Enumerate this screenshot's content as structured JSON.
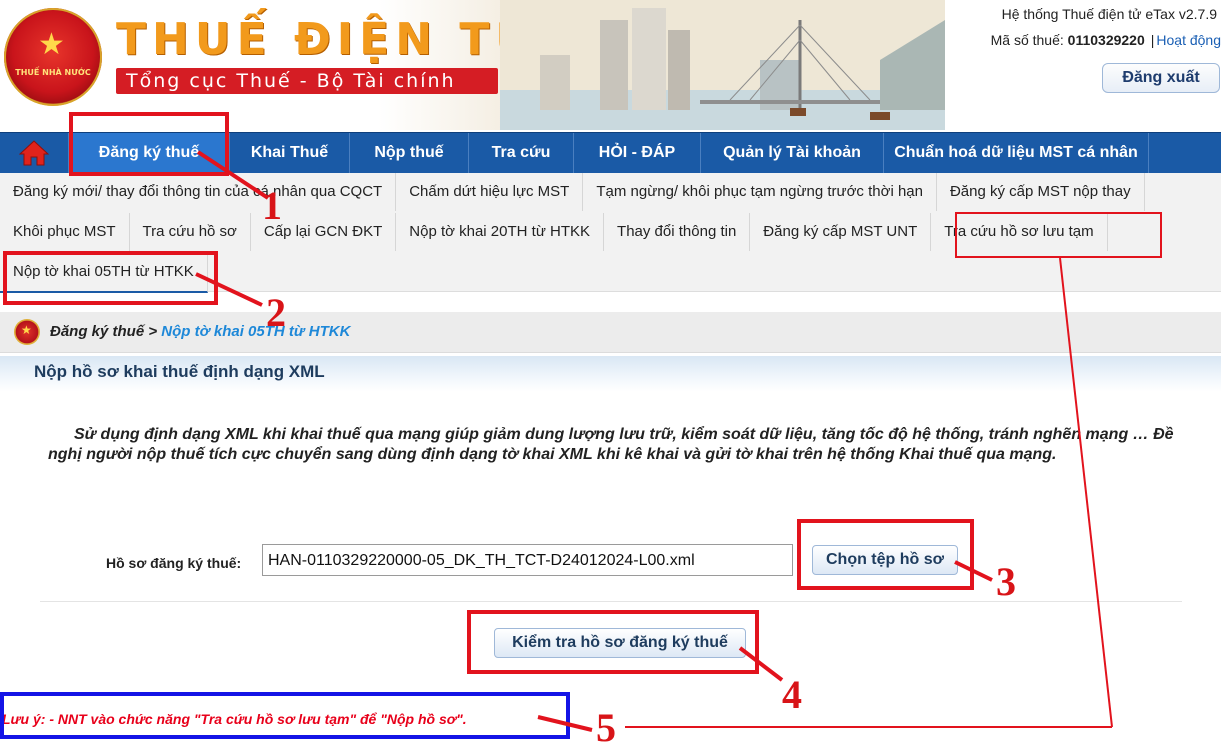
{
  "header": {
    "site_title": "THUẾ ĐIỆN TỬ",
    "site_subtitle": "Tổng cục Thuế - Bộ Tài chính",
    "emblem_text": "THUẾ NHÀ NƯỚC",
    "system_name": "Hệ thống Thuế điện tử eTax v2.7.9",
    "tax_code_label": "Mã số thuế:",
    "tax_code_value": "0110329220",
    "status_link": "Hoạt động",
    "logout_label": "Đăng xuất"
  },
  "main_nav": {
    "home_icon": "home-icon",
    "items": [
      {
        "label": "Đăng ký thuế"
      },
      {
        "label": "Khai Thuế"
      },
      {
        "label": "Nộp thuế"
      },
      {
        "label": "Tra cứu"
      },
      {
        "label": "HỎI - ĐÁP"
      },
      {
        "label": "Quản lý Tài khoản"
      },
      {
        "label": "Chuẩn hoá dữ liệu MST cá nhân"
      }
    ]
  },
  "sub_nav": {
    "items": [
      {
        "label": "Đăng ký mới/ thay đổi thông tin của cá nhân qua CQCT"
      },
      {
        "label": "Chấm dứt hiệu lực MST"
      },
      {
        "label": "Tạm ngừng/ khôi phục tạm ngừng trước thời hạn"
      },
      {
        "label": "Đăng ký cấp MST nộp thay"
      },
      {
        "label": "Khôi phục MST"
      },
      {
        "label": "Tra cứu hồ sơ"
      },
      {
        "label": "Cấp lại GCN ĐKT"
      },
      {
        "label": "Nộp tờ khai 20TH từ HTKK"
      },
      {
        "label": "Thay đổi thông tin"
      },
      {
        "label": "Đăng ký cấp MST UNT"
      },
      {
        "label": "Tra cứu hồ sơ lưu tạm"
      },
      {
        "label": "Nộp tờ khai 05TH từ HTKK"
      }
    ]
  },
  "breadcrumb": {
    "parent": "Đăng ký thuế",
    "separator": ">",
    "current": "Nộp tờ khai 05TH từ HTKK"
  },
  "content": {
    "page_title": "Nộp hồ sơ khai thuế định dạng XML",
    "notice": "Sử dụng định dạng XML khi khai thuế qua mạng giúp giảm dung lượng lưu trữ, kiểm soát dữ liệu, tăng tốc độ hệ thống, tránh nghẽn mạng … Đề nghị người nộp thuế tích cực chuyển sang dùng định dạng tờ khai XML khi kê khai và gửi tờ khai trên hệ thống Khai thuế qua mạng.",
    "file_label": "Hồ sơ đăng ký thuế:",
    "file_value": "HAN-0110329220000-05_DK_TH_TCT-D24012024-L00.xml",
    "choose_file_button": "Chọn tệp hồ sơ",
    "check_button": "Kiểm tra hồ sơ đăng ký thuế",
    "note": "Lưu ý:   - NNT vào chức năng \"Tra cứu hồ sơ lưu tạm\" để \"Nộp hồ sơ\"."
  },
  "annotations": {
    "numbers": [
      "1",
      "2",
      "3",
      "4",
      "5"
    ],
    "colors": {
      "red": "#e2131d",
      "blue": "#1414e6"
    }
  }
}
